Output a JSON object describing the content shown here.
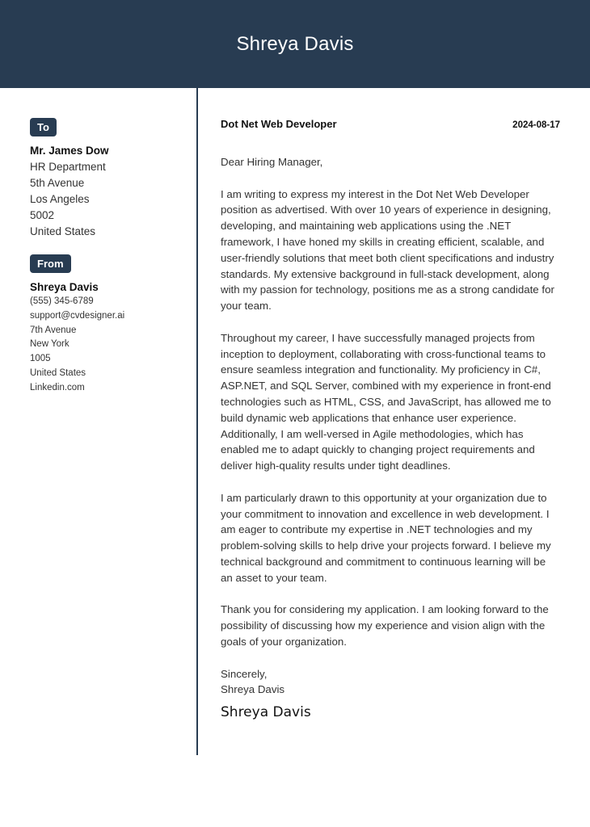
{
  "header": {
    "name": "Shreya Davis",
    "background_color": "#283c52"
  },
  "recipient": {
    "badge_label": "To",
    "name": "Mr. James Dow",
    "lines": [
      "HR Department",
      "5th Avenue",
      "Los Angeles",
      "5002",
      "United States"
    ]
  },
  "sender": {
    "badge_label": "From",
    "name": "Shreya Davis",
    "lines": [
      "(555) 345-6789",
      "support@cvdesigner.ai",
      "7th Avenue",
      "New York",
      "1005",
      "United States",
      "Linkedin.com"
    ]
  },
  "letter": {
    "job_title": "Dot Net Web Developer",
    "date": "2024-08-17",
    "salutation": "Dear Hiring Manager,",
    "paragraphs": [
      "I am writing to express my interest in the Dot Net Web Developer position as advertised. With over 10 years of experience in designing, developing, and maintaining web applications using the .NET framework, I have honed my skills in creating efficient, scalable, and user-friendly solutions that meet both client specifications and industry standards. My extensive background in full-stack development, along with my passion for technology, positions me as a strong candidate for your team.",
      "Throughout my career, I have successfully managed projects from inception to deployment, collaborating with cross-functional teams to ensure seamless integration and functionality. My proficiency in C#, ASP.NET, and SQL Server, combined with my experience in front-end technologies such as HTML, CSS, and JavaScript, has allowed me to build dynamic web applications that enhance user experience. Additionally, I am well-versed in Agile methodologies, which has enabled me to adapt quickly to changing project requirements and deliver high-quality results under tight deadlines.",
      "I am particularly drawn to this opportunity at your organization due to your commitment to innovation and excellence in web development. I am eager to contribute my expertise in .NET technologies and my problem-solving skills to help drive your projects forward. I believe my technical background and commitment to continuous learning will be an asset to your team.",
      "Thank you for considering my application. I am looking forward to the possibility of discussing how my experience and vision align with the goals of your organization."
    ],
    "closing": "Sincerely,",
    "closing_name": "Shreya Davis",
    "signature": "Shreya Davis"
  }
}
